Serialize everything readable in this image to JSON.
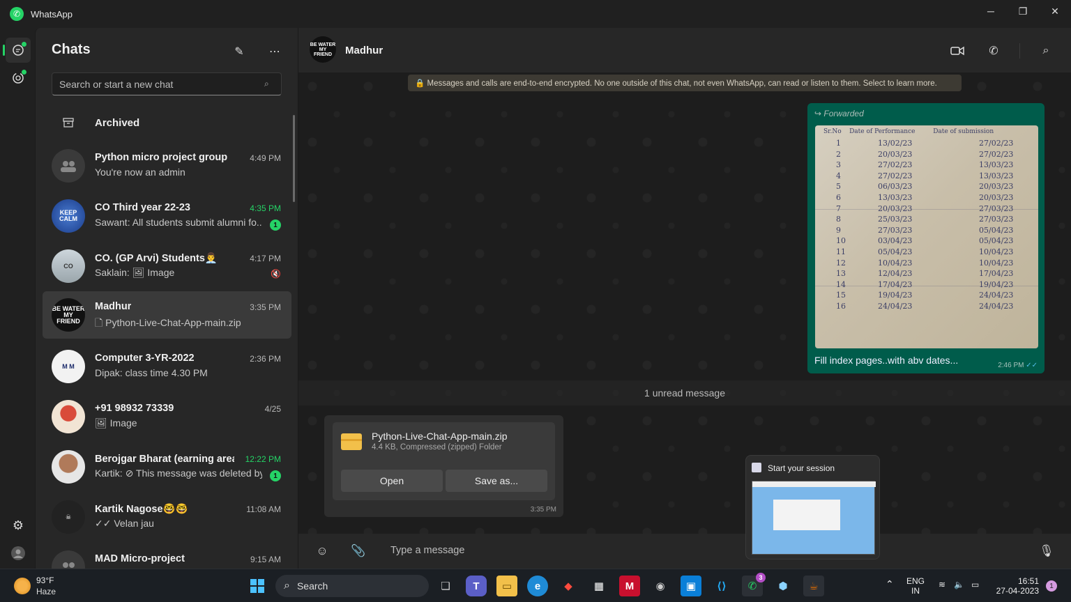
{
  "app": {
    "title": "WhatsApp"
  },
  "chatlist": {
    "title": "Chats",
    "search_placeholder": "Search or start a new chat",
    "archived_label": "Archived",
    "chats": [
      {
        "name": "Python micro project group",
        "time": "4:49 PM",
        "message": "You're now an admin"
      },
      {
        "name": "CO Third year 22-23",
        "time": "4:35 PM",
        "message": "Sawant: All students submit alumni fo...",
        "unread": "1"
      },
      {
        "name": "CO. (GP Arvi) Students👨‍💼",
        "time": "4:17 PM",
        "message": "Saklain: 🖼 Image"
      },
      {
        "name": "Madhur",
        "time": "3:35 PM",
        "message": "🗋 Python-Live-Chat-App-main.zip"
      },
      {
        "name": "Computer 3-YR-2022",
        "time": "2:36 PM",
        "message": "Dipak: class time 4.30 PM"
      },
      {
        "name": "+91 98932 73339",
        "time": "4/25",
        "message": "🖼 Image"
      },
      {
        "name": "Berojgar Bharat (earning area ) 🤚",
        "time": "12:22 PM",
        "message": "Kartik: ⊘ This message was deleted by...",
        "unread": "1"
      },
      {
        "name": "Kartik Nagose🤓🤓",
        "time": "11:08 AM",
        "message": "✓✓ Velan jau"
      },
      {
        "name": "MAD Micro-project",
        "time": "9:15 AM",
        "message": ""
      }
    ]
  },
  "conversation": {
    "contact_name": "Madhur",
    "avatar_text": "BE WATER MY FRIEND",
    "encryption_notice": "🔒 Messages and calls are end-to-end encrypted. No one outside of this chat, not even WhatsApp, can read or listen to them. Select to learn more.",
    "forwarded_label": "Forwarded",
    "photo_caption": "Fill index pages..with abv dates...",
    "photo_time": "2:46 PM",
    "unread_divider": "1 unread message",
    "file": {
      "name": "Python-Live-Chat-App-main.zip",
      "meta": "4.4 KB, Compressed (zipped) Folder",
      "open_label": "Open",
      "save_label": "Save as...",
      "time": "3:35 PM"
    },
    "compose_placeholder": "Type a message"
  },
  "popup": {
    "title": "Start your session"
  },
  "taskbar": {
    "weather_temp": "93°F",
    "weather_desc": "Haze",
    "search_label": "Search",
    "whatsapp_badge": "3",
    "lang": "ENG",
    "region": "IN",
    "time": "16:51",
    "date": "27-04-2023",
    "notification_count": "1"
  },
  "colors": {
    "accent": "#25d366",
    "outgoing_bubble": "#005c4b",
    "background": "#202020"
  }
}
